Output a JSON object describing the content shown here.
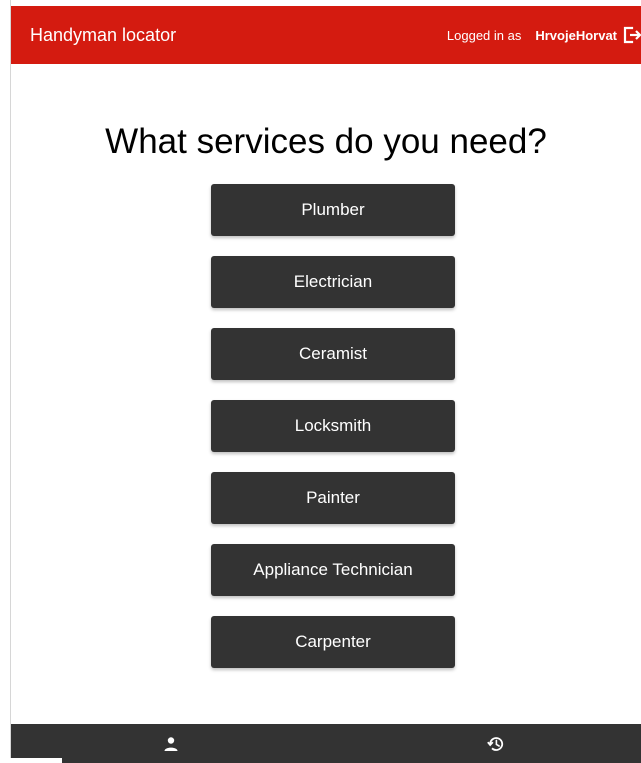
{
  "app_bar": {
    "title": "Handyman locator",
    "logged_in_label": "Logged in as",
    "username": "HrvojeHorvat",
    "logout_icon": "logout-icon",
    "background_color": "#d41b10"
  },
  "main": {
    "heading": "What services do you need?",
    "services": [
      {
        "label": "Plumber"
      },
      {
        "label": "Electrician"
      },
      {
        "label": "Ceramist"
      },
      {
        "label": "Locksmith"
      },
      {
        "label": "Painter"
      },
      {
        "label": "Appliance Technician"
      },
      {
        "label": "Carpenter"
      }
    ],
    "button_color": "#333333"
  },
  "bottom_nav": {
    "items": [
      {
        "icon": "person-icon"
      },
      {
        "icon": "history-icon"
      }
    ],
    "background_color": "#333333"
  }
}
